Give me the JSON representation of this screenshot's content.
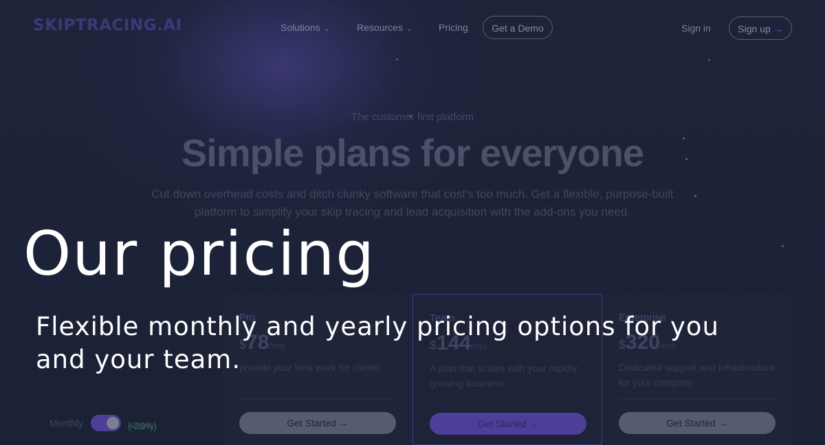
{
  "brand": {
    "logo_text": "SKIPTRACING.AI",
    "accent": "#6a56d8",
    "background": "#1c2236"
  },
  "nav": {
    "solutions": "Solutions",
    "resources": "Resources",
    "pricing": "Pricing",
    "demo": "Get a Demo",
    "sign_in": "Sign in",
    "sign_up": "Sign up",
    "chevron_glyph": "⌄",
    "arrow_glyph": "→"
  },
  "hero": {
    "eyebrow": "The customer first platform",
    "title": "Simple plans for everyone",
    "subtitle": "Cut down overhead costs and ditch clunky software that cost's too much. Get a flexible, purpose-built platform to simplify your skip tracing and lead acquisition with the add-ons you need."
  },
  "billing": {
    "monthly": "Monthly",
    "yearly": "Yearly",
    "discount": "(-20%)",
    "yearly_selected": true
  },
  "plans": [
    {
      "name": "Pro",
      "currency": "$",
      "price": "78",
      "period": "/mo",
      "description": "provide your best work for clients.",
      "cta": "Get Started"
    },
    {
      "name": "Team",
      "currency": "$",
      "price": "144",
      "period": "/mo",
      "description": "A plan that scales with your rapidly growing business.",
      "cta": "Get Started"
    },
    {
      "name": "Enterprise",
      "currency": "$",
      "price": "320",
      "period": "/mo",
      "description": "Dedicated support and infrastructure for your company.",
      "cta": "Get Started"
    }
  ],
  "overlay": {
    "title": "Our pricing",
    "subtitle": "Flexible monthly and yearly pricing options for you and your team."
  }
}
